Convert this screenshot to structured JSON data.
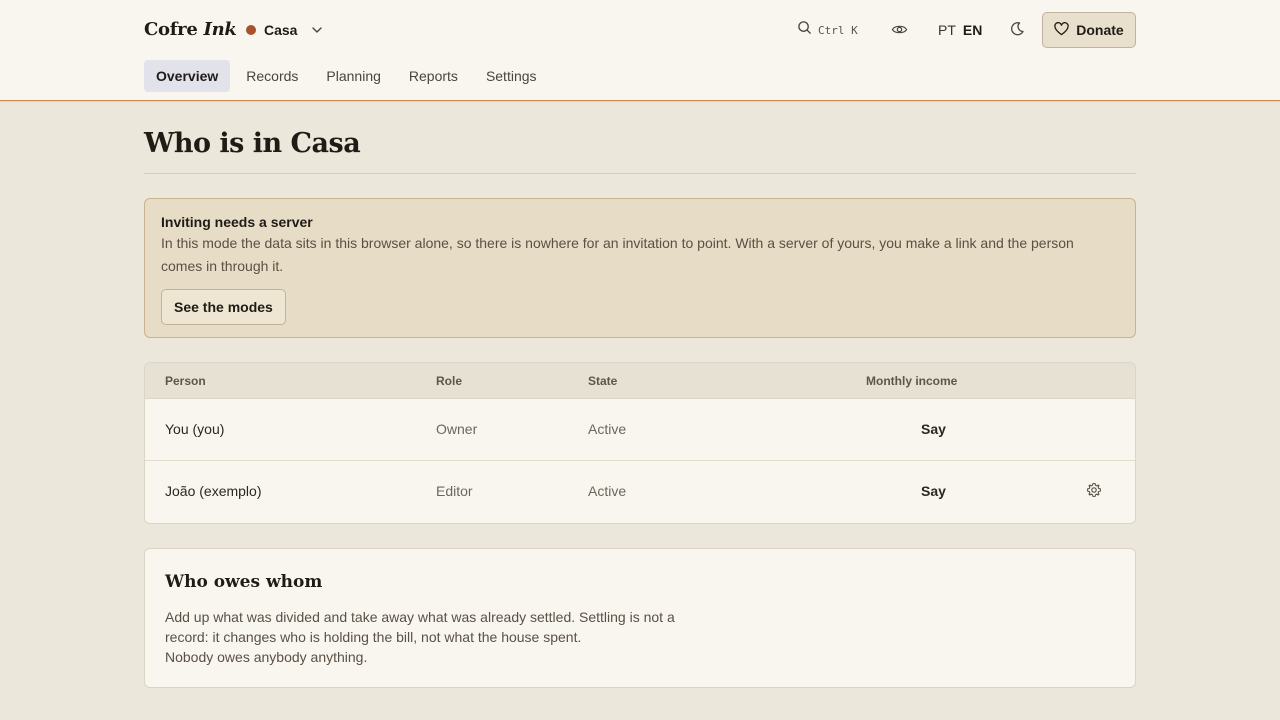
{
  "header": {
    "brand_main": "Cofre",
    "brand_ink": "Ink",
    "household": {
      "name": "Casa",
      "color": "#a5532a",
      "icon": "chevron-down-icon"
    },
    "search_shortcut": "Ctrl K",
    "languages": [
      {
        "label": "PT",
        "active": false
      },
      {
        "label": "EN",
        "active": true
      }
    ],
    "donate_label": "Donate"
  },
  "tabs": [
    {
      "label": "Overview",
      "active": true
    },
    {
      "label": "Records",
      "active": false
    },
    {
      "label": "Planning",
      "active": false
    },
    {
      "label": "Reports",
      "active": false
    },
    {
      "label": "Settings",
      "active": false
    }
  ],
  "page": {
    "title": "Who is in Casa"
  },
  "notice": {
    "title": "Inviting needs a server",
    "body": "In this mode the data sits in this browser alone, so there is nowhere for an invitation to point. With a server of yours, you make a link and the person comes in through it.",
    "button_label": "See the modes"
  },
  "members": {
    "columns": [
      "Person",
      "Role",
      "State",
      "Monthly income"
    ],
    "rows": [
      {
        "person": "You (you)",
        "role": "Owner",
        "state": "Active",
        "income": "Say",
        "has_settings": false
      },
      {
        "person": "João (exemplo)",
        "role": "Editor",
        "state": "Active",
        "income": "Say",
        "has_settings": true
      }
    ]
  },
  "owes": {
    "title": "Who owes whom",
    "lines": [
      "Add up what was divided and take away what was already settled. Settling is not a record: it changes who is holding the bill, not what the house spent.",
      "Nobody owes anybody anything."
    ]
  },
  "colors": {
    "accent": "#a5532a",
    "notice_bg": "#e7dcc5",
    "page_bg": "#ece7db"
  }
}
